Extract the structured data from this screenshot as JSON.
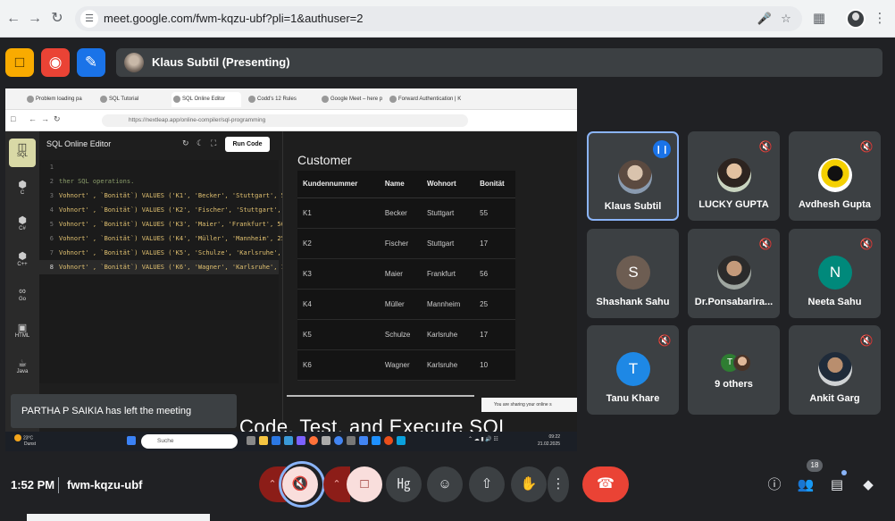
{
  "browser": {
    "url": "meet.google.com/fwm-kqzu-ubf?pli=1&authuser=2",
    "back_icon": "arrow-left",
    "forward_icon": "arrow-right",
    "reload_icon": "reload"
  },
  "meet_header": {
    "presenter_name": "Klaus Subtil (Presenting)",
    "colors": {
      "yellow_tool": "#f9ab00",
      "red_tool": "#ea4335",
      "blue_tool": "#1a73e8"
    }
  },
  "shared_screen": {
    "tabs": [
      "Problem loading pa",
      "SQL Tutorial",
      "SQL Online Editor",
      "Codd's 12 Rules",
      "Google Meet – here playing",
      "Forward Authentication | K"
    ],
    "url": "https://nextleap.app/online-compiler/sql-programming",
    "editor_title": "SQL Online Editor",
    "run_button": "Run Code",
    "languages": [
      "SQL",
      "C",
      "C#",
      "C++",
      "Go",
      "HTML",
      "Java"
    ],
    "code_lines": [
      {
        "num": "1",
        "text": ""
      },
      {
        "num": "2",
        "text": "ther SQL operations."
      },
      {
        "num": "3",
        "text": "Vohnort' , `Bonität`) VALUES ('K1', 'Becker', 'Stuttgart', 55);"
      },
      {
        "num": "4",
        "text": "Vohnort' , `Bonität`) VALUES ('K2', 'Fischer', 'Stuttgart', 17);"
      },
      {
        "num": "5",
        "text": "Vohnort' , `Bonität`) VALUES ('K3', 'Maier', 'Frankfurt', 56);"
      },
      {
        "num": "6",
        "text": "Vohnort' , `Bonität`) VALUES ('K4', 'Müller', 'Mannheim', 25);"
      },
      {
        "num": "7",
        "text": "Vohnort' , `Bonität`) VALUES ('K5', 'Schulze', 'Karlsruhe', 17);"
      },
      {
        "num": "8",
        "text": "Vohnort' , `Bonität`) VALUES ('K6', 'Wagner', 'Karlsruhe', 10);"
      }
    ],
    "result_title": "Customer",
    "columns": [
      "Kundennummer",
      "Name",
      "Wohnort",
      "Bonität"
    ],
    "rows": [
      [
        "K1",
        "Becker",
        "Stuttgart",
        "55"
      ],
      [
        "K2",
        "Fischer",
        "Stuttgart",
        "17"
      ],
      [
        "K3",
        "Maier",
        "Frankfurt",
        "56"
      ],
      [
        "K4",
        "Müller",
        "Mannheim",
        "25"
      ],
      [
        "K5",
        "Schulze",
        "Karlsruhe",
        "17"
      ],
      [
        "K6",
        "Wagner",
        "Karlsruhe",
        "10"
      ]
    ],
    "toast": "PARTHA P SAIKIA has left the meeting",
    "share_banner": "You are sharing your online s",
    "slide_text": "Code, Test, and Execute SQL",
    "taskbar": {
      "temp": "23°C",
      "weather": "Dunst",
      "search": "Suche",
      "time": "09:22",
      "date": "21.02.2025"
    }
  },
  "participants": [
    {
      "name": "Klaus Subtil",
      "speaking": true,
      "avatar": "photo"
    },
    {
      "name": "LUCKY GUPTA",
      "muted": true,
      "avatar": "photo2"
    },
    {
      "name": "Avdhesh Gupta",
      "muted": true,
      "avatar": "photo3"
    },
    {
      "name": "Shashank Sahu",
      "initial": "S",
      "color": "#6d5d52"
    },
    {
      "name": "Dr.Ponsabarira...",
      "muted": true,
      "avatar": "photo4"
    },
    {
      "name": "Neeta Sahu",
      "initial": "N",
      "color": "#00897b",
      "muted": true
    },
    {
      "name": "Tanu Khare",
      "initial": "T",
      "color": "#1e88e5",
      "muted": true
    },
    {
      "name": "9 others",
      "others_initial": "T"
    },
    {
      "name": "Ankit Garg",
      "muted": true,
      "avatar": "photo5"
    }
  ],
  "bottom_bar": {
    "time": "1:52 PM",
    "meeting_code": "fwm-kqzu-ubf",
    "people_count": "18",
    "end_call_color": "#ea4335"
  }
}
